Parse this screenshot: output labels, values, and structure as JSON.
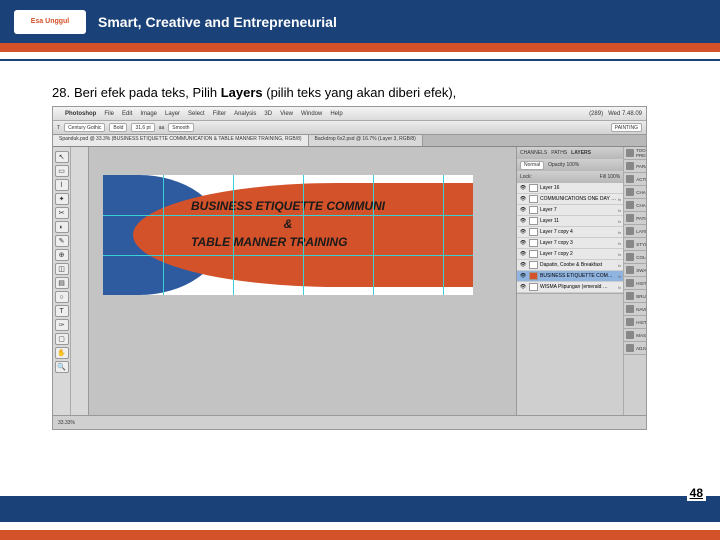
{
  "header": {
    "logo_text": "Esa Unggul",
    "tagline": "Smart, Creative and Entrepreneurial"
  },
  "instruction": {
    "number": "28.",
    "text_before": "Beri efek pada teks, Pilih ",
    "bold": "Layers",
    "text_after": " (pilih teks yang akan diberi efek),"
  },
  "mac_menu": {
    "app": "Photoshop",
    "items": [
      "File",
      "Edit",
      "Image",
      "Layer",
      "Select",
      "Filter",
      "Analysis",
      "3D",
      "View",
      "Window",
      "Help"
    ],
    "status": [
      "(289)",
      "Wed 7.48.09"
    ]
  },
  "options_bar": {
    "font": "Century Gothic",
    "weight": "Bold",
    "size": "31,6 pt",
    "aa": "Smooth",
    "mode": "PAINTING"
  },
  "doc_tabs": [
    "Spanduk.psd @ 33.3% (BUSINESS ETIQUETTE COMMUNICATION & TABLE MANNER TRAINING, RGB/8)",
    "Backdrop 6x2.psd @ 16.7% (Layer 3, RGB/8)"
  ],
  "artwork": {
    "line1": "BUSINESS ETIQUETTE COMMUNI",
    "amp": "&",
    "line2": "TABLE MANNER TRAINING"
  },
  "panel_tabs": {
    "group1": [
      "CHANNELS",
      "PATHS",
      "LAYERS"
    ]
  },
  "layers_panel": {
    "mode": "Normal",
    "opacity": "Opacity 100%",
    "lock": "Lock:",
    "fill": "Fill 100%",
    "rows": [
      {
        "name": "Layer 16",
        "fx": ""
      },
      {
        "name": "COMMUNICATIONS ONE DAY …",
        "fx": "fx"
      },
      {
        "name": "Layer 7",
        "fx": "fx"
      },
      {
        "name": "Layer 11",
        "fx": "fx"
      },
      {
        "name": "Layer 7 copy 4",
        "fx": "fx"
      },
      {
        "name": "Layer 7 copy 3",
        "fx": "fx"
      },
      {
        "name": "Layer 7 copy 2",
        "fx": "fx"
      },
      {
        "name": "Dapatin, Coobe & Breakfast",
        "fx": "fx"
      },
      {
        "name": "BUSINESS ETIQUETTE COM…",
        "fx": "fx",
        "sel": true
      },
      {
        "name": "WISMA Plipungan (emerald …",
        "fx": "fx"
      }
    ]
  },
  "side_tabs": [
    "TOOL PRESETS",
    "PARAGRAPH",
    "ACTIONS",
    "CHARACTER",
    "CHANNELS",
    "PATHS",
    "LAYERS",
    "STYLES",
    "COLOR",
    "SWATCHES",
    "HISTOGRAM",
    "BRUSHES",
    "NAVIGATOR",
    "HISTORY",
    "MASKS",
    "ADJUSTMENTS"
  ],
  "status_bar": "33.33%",
  "page_number": "48"
}
